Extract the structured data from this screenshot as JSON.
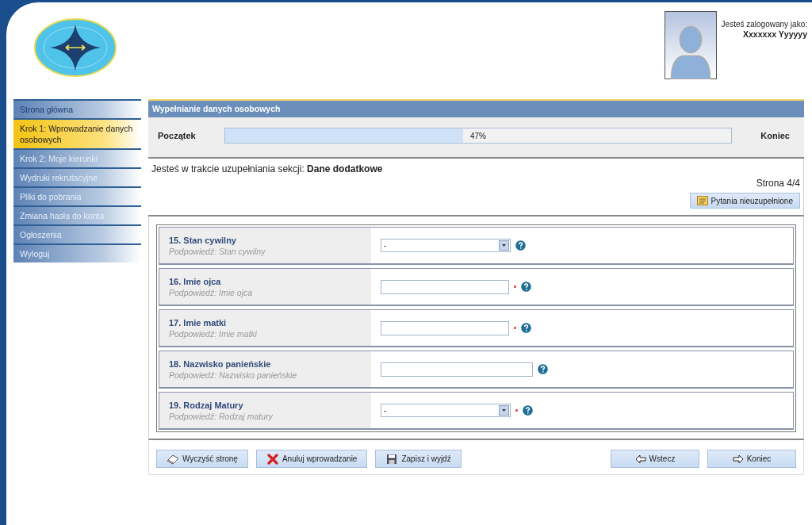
{
  "header": {
    "user_label": "Jesteś zalogowany jako:",
    "user_name": "Xxxxxxx Yyyyyy"
  },
  "sidebar": {
    "items": [
      {
        "label": "Strona główna",
        "selected": false
      },
      {
        "label": "Krok 1: Wprowadzanie danych osobowych",
        "selected": true
      },
      {
        "label": "Krok 2: Moje kierunki",
        "selected": false
      },
      {
        "label": "Wydruki rekrutacyjne",
        "selected": false
      },
      {
        "label": "Pliki do pobrania",
        "selected": false
      },
      {
        "label": "Zmiana hasła do konta",
        "selected": false
      },
      {
        "label": "Ogłoszenia",
        "selected": false
      },
      {
        "label": "Wyloguj",
        "selected": false
      }
    ]
  },
  "panel": {
    "title": "Wypełnianie danych osobowych",
    "progress": {
      "start_label": "Początek",
      "end_label": "Koniec",
      "level": 0.47,
      "reading": "47%"
    },
    "section_text": "Jesteś w trakcie uzupełniania sekcji: **Dane dodatkowe**",
    "page": "Strona 4/4",
    "unanswered_button": "Pytania nieuzupełnione",
    "questions": [
      {
        "kind": "select",
        "label": "15. Stan cywilny",
        "hint": "Podpowiedź: Stan cywilny",
        "value": "-",
        "required": false
      },
      {
        "kind": "text",
        "label": "16. Imie ojca",
        "hint": "Podpowiedź: Imie ojca",
        "required": true
      },
      {
        "kind": "text",
        "label": "17. Imie matki",
        "hint": "Podpowiedź: Imie matki",
        "required": true
      },
      {
        "kind": "long_text",
        "label": "18. Nazwisko panieńskie",
        "hint": "Podpowiedź: Nazwisko panieńskie",
        "required": false
      },
      {
        "kind": "select",
        "label": "19. Rodzaj Matury",
        "hint": "Podpowiedź: Rodzaj matury",
        "value": "-",
        "required": true
      }
    ],
    "left_buttons": [
      {
        "kind": "clear",
        "label": "Wyczyść stronę"
      },
      {
        "kind": "cancel",
        "label": "Anuluj wprowadzanie"
      },
      {
        "kind": "save",
        "label": "Zapisz i wyjdź"
      }
    ],
    "right_buttons": [
      {
        "kind": "back",
        "label": "Wstecz"
      },
      {
        "kind": "next",
        "label": "Koniec"
      }
    ]
  }
}
